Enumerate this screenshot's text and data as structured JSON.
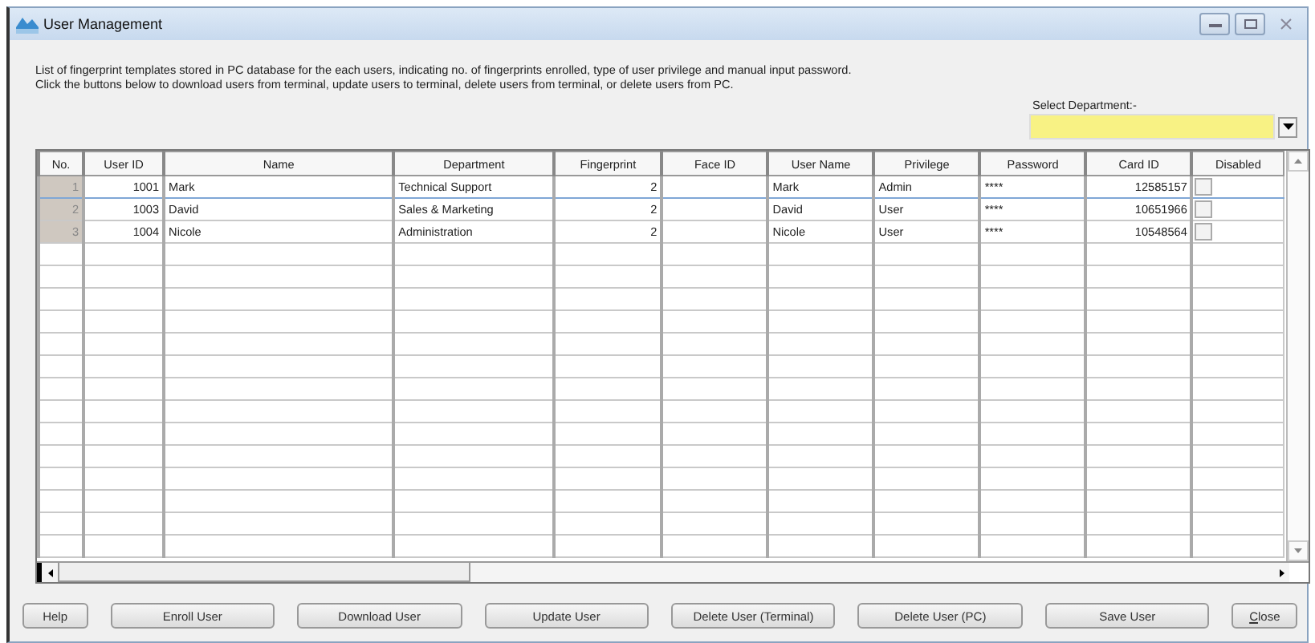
{
  "window": {
    "title": "User Management"
  },
  "description": [
    "List of fingerprint templates stored in PC database for the each users, indicating no. of fingerprints enrolled, type of user privilege and manual input password.",
    "Click the buttons below to download users from terminal, update users to terminal, delete users from terminal, or delete users from PC."
  ],
  "department_filter": {
    "label": "Select Department:-"
  },
  "table": {
    "columns": [
      "No.",
      "User ID",
      "Name",
      "Department",
      "Fingerprint",
      "Face ID",
      "User Name",
      "Privilege",
      "Password",
      "Card ID",
      "Disabled"
    ],
    "rows": [
      {
        "no": "1",
        "user_id": "1001",
        "name": "Mark",
        "department": "Technical Support",
        "fingerprint": "2",
        "user_name": "Mark",
        "privilege": "Admin",
        "password": "****",
        "card_id": "12585157",
        "disabled": false,
        "selected": true
      },
      {
        "no": "2",
        "user_id": "1003",
        "name": "David",
        "department": "Sales & Marketing",
        "fingerprint": "2",
        "user_name": "David",
        "privilege": "User",
        "password": "****",
        "card_id": "10651966",
        "disabled": false,
        "selected": false
      },
      {
        "no": "3",
        "user_id": "1004",
        "name": "Nicole",
        "department": "Administration",
        "fingerprint": "2",
        "user_name": "Nicole",
        "privilege": "User",
        "password": "****",
        "card_id": "10548564",
        "disabled": false,
        "selected": false
      }
    ]
  },
  "buttons": [
    {
      "label": "Help",
      "mnemonic": false,
      "kind": "small"
    },
    {
      "label": "Enroll User",
      "mnemonic": false,
      "kind": "wide"
    },
    {
      "label": "Download User",
      "mnemonic": false,
      "kind": "wide"
    },
    {
      "label": "Update User",
      "mnemonic": false,
      "kind": "wide"
    },
    {
      "label": "Delete User (Terminal)",
      "mnemonic": false,
      "kind": "wide"
    },
    {
      "label": "Delete User (PC)",
      "mnemonic": false,
      "kind": "wide"
    },
    {
      "label": "Save User",
      "mnemonic": false,
      "kind": "wide"
    },
    {
      "label": "Close",
      "mnemonic": true,
      "kind": "small"
    }
  ]
}
